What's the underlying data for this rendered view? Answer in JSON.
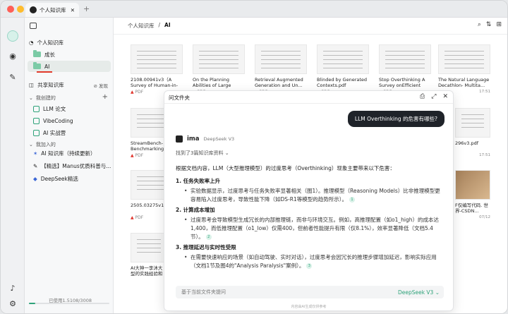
{
  "titlebar": {
    "tab_label": "个人知识库"
  },
  "breadcrumb": {
    "root": "个人知识库",
    "sep": "/",
    "current": "AI"
  },
  "sidebar": {
    "personal_kb": "个人知识库",
    "folders": [
      {
        "label": "成长",
        "active": false
      },
      {
        "label": "AI",
        "active": true
      }
    ],
    "shared_kb": "共享知识库",
    "discover": "发现",
    "created_section": "我创建的",
    "created_items": [
      "LLM 论文",
      "VibeCoding",
      "AI  实战营"
    ],
    "joined_section": "我加入的",
    "joined_items": [
      "AI 知识库（持续更新）",
      "【精选】Manus优质科普与...",
      "DeepSeek精选"
    ],
    "storage_text": "已使用1.5108/3008",
    "storage_used_fraction": 0.08
  },
  "cards_row1": [
    {
      "title": "2108.00941v3（A Survey of Human-in-the...",
      "type": "PDF",
      "time": ""
    },
    {
      "title": "On the Planning Abilities of Large Langua...",
      "type": "PDF",
      "time": ""
    },
    {
      "title": "Retrieval Augmented Generation and Un...",
      "type": "PDF",
      "time": ""
    },
    {
      "title": "Blinded by Generated Contexts.pdf",
      "type": "PDF",
      "time": ""
    },
    {
      "title": "Stop Overthinking A Survey onEfficient Re...",
      "type": "PDF",
      "time": ""
    },
    {
      "title": "The Natural Language Decathlon- Multita...",
      "type": "",
      "time": "17:51"
    }
  ],
  "cards_row2": [
    {
      "title": "StreamBench- s Benchmarking",
      "type": "PDF"
    },
    {
      "title": "296v3.pdf",
      "type": "",
      "time": "17:51"
    }
  ],
  "cards_row3": [
    {
      "title": "2505.03275v1.p",
      "type": "PDF"
    },
    {
      "title": "F仅编写代码. 世界-CSDN...",
      "type": "",
      "time": "07/12"
    }
  ],
  "cards_row4": [
    {
      "title": "AI大神一李沐大 型的实践经验和"
    }
  ],
  "panel": {
    "title": "问文件夹",
    "question": "LLM Overthinking 的危害有哪些?",
    "assistant": "ima",
    "model": "DeepSeek V3",
    "found_text": "找到了3篇知识库资料",
    "intro": "根据文档内容，LLM（大型推理模型）的过度思考（Overthinking）现象主要带来以下危害：",
    "points": [
      {
        "heading": "1. 任务失败率上升",
        "text": "实验数据显示，过度思考与任务失败率显著相关（图1）。推理模型（Reasoning Models）比非推理模型更容易陷入过度思考，导致性能下降（如DS-R1等模型的趋势所示）。",
        "cite": "1"
      },
      {
        "heading": "2. 计算成本增加",
        "text": "过度思考会导致模型生成冗长的内部推理链，而非与环境交互。例如，高推理配置（如o1_high）的成本达1,400，而低推理配置（o1_low）仅需400，但前者性能提升有限（仅8.1%），效率显著降低（文档5.4节）。",
        "cite": "2"
      },
      {
        "heading": "3. 推理延迟与实时性受限",
        "text": "在需要快速响应的场景（如自动驾驶、实时对话），过度思考会因冗长的推理步骤增加延迟，影响实际应用（文档1节及图4的\"Analysis Paralysis\"案例）。",
        "cite": "3"
      }
    ],
    "input_placeholder": "基于当前文件夹提问",
    "model_select": "DeepSeek V3",
    "disclaimer": "内容由AI生成仅供参考"
  },
  "colors": {
    "accent": "#2fa37a",
    "danger": "#e23a2b",
    "bubble": "#1f2329"
  }
}
